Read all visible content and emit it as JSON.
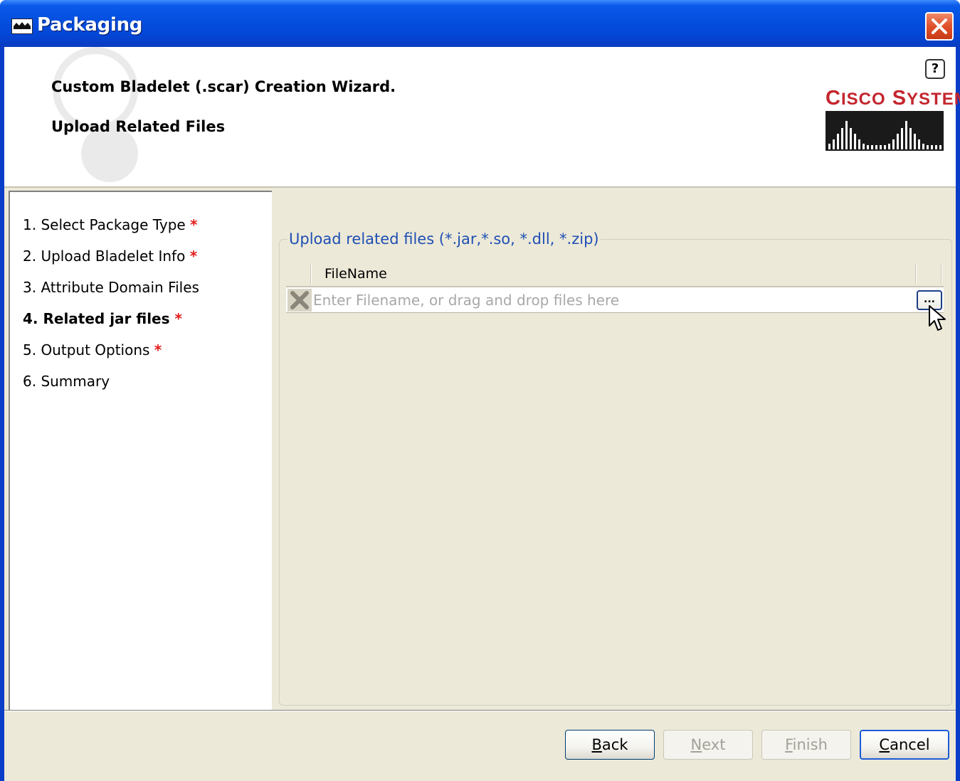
{
  "window": {
    "title": "Packaging"
  },
  "header": {
    "wizard_title": "Custom Bladelet (.scar) Creation Wizard.",
    "page_subtitle": "Upload Related Files",
    "help_label": "?",
    "brand": {
      "cisco_c": "C",
      "cisco_isco": "ISCO",
      "cisco_s": "S",
      "cisco_ystems": "YSTEMS",
      "color": "#c4262e"
    }
  },
  "nav": {
    "steps": [
      {
        "label": "1. Select Package Type",
        "required": "*",
        "active": false
      },
      {
        "label": "2. Upload Bladelet Info",
        "required": "*",
        "active": false
      },
      {
        "label": "3. Attribute Domain Files",
        "required": "",
        "active": false
      },
      {
        "label": "4. Related jar files",
        "required": "*",
        "active": true
      },
      {
        "label": "5. Output Options",
        "required": "*",
        "active": false
      },
      {
        "label": "6. Summary",
        "required": "",
        "active": false
      }
    ]
  },
  "content": {
    "group_label": "Upload related files (*.jar,*.so, *.dll, *.zip)",
    "table": {
      "column_header": "FileName",
      "input_placeholder": "Enter Filename, or drag and drop files here",
      "input_value": "",
      "browse_label": "..."
    }
  },
  "footer": {
    "back_prefix": "",
    "back_mnemonic": "B",
    "back_rest": "ack",
    "next_mnemonic": "N",
    "next_rest": "ext",
    "finish_mnemonic": "F",
    "finish_rest": "inish",
    "cancel_mnemonic": "C",
    "cancel_rest": "ancel"
  },
  "colors": {
    "titlebar": "#0550e0",
    "group_label": "#1f4fb4",
    "required_mark": "#e41a1a",
    "dialog_bg": "#ece9d8"
  },
  "icons": {
    "app": "packaging-app-icon",
    "close": "close-icon",
    "help": "help-icon",
    "delete": "delete-x-icon",
    "cursor": "mouse-pointer-icon"
  }
}
